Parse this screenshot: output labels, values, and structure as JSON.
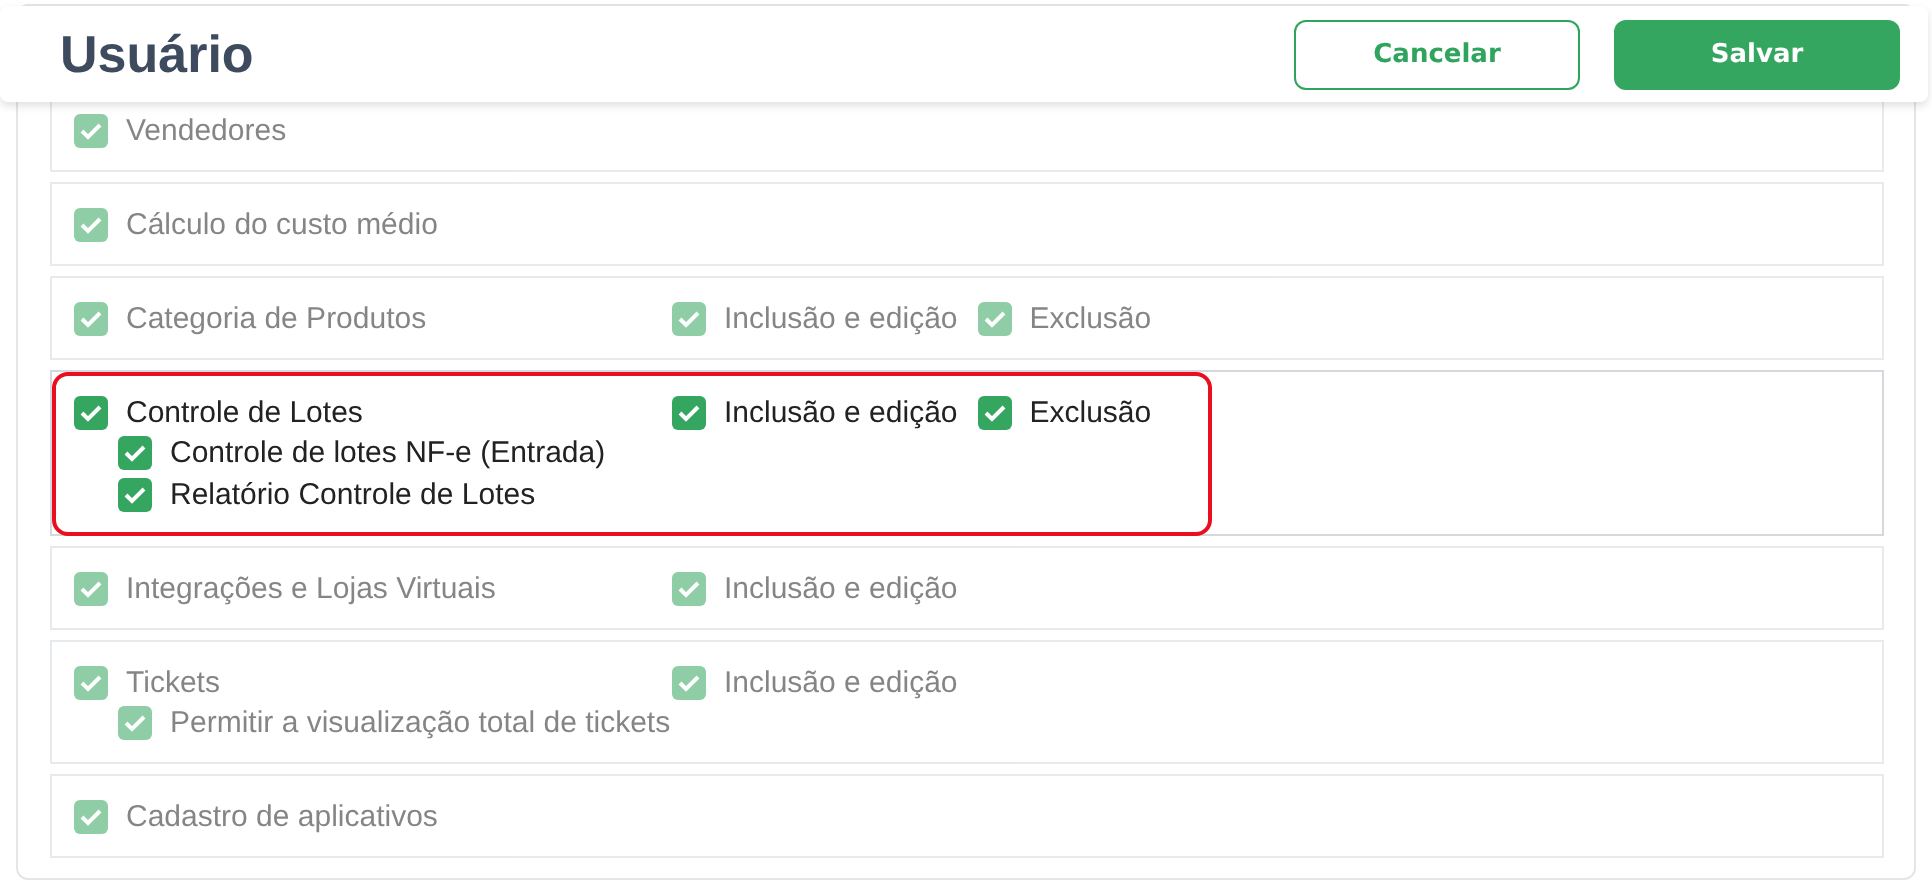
{
  "header": {
    "title": "Usuário",
    "buttons": [
      {
        "label": "Cancelar",
        "kind": "outline"
      },
      {
        "label": "Salvar",
        "kind": "primary"
      }
    ]
  },
  "sections": [
    {
      "label": "Vendedores",
      "checked": true,
      "blurred": true,
      "highlighted": false
    },
    {
      "label": "Cálculo do custo médio",
      "checked": true,
      "blurred": true,
      "highlighted": false
    },
    {
      "label": "Categoria de Produtos",
      "checked": true,
      "blurred": true,
      "highlighted": false,
      "permissions": [
        {
          "label": "Inclusão e edição",
          "checked": true
        },
        {
          "label": "Exclusão",
          "checked": true
        }
      ]
    },
    {
      "label": "Controle de Lotes",
      "checked": true,
      "blurred": false,
      "highlighted": true,
      "permissions": [
        {
          "label": "Inclusão e edição",
          "checked": true
        },
        {
          "label": "Exclusão",
          "checked": true
        }
      ],
      "children": [
        {
          "label": "Controle de lotes NF-e (Entrada)",
          "checked": true
        },
        {
          "label": "Relatório Controle de Lotes",
          "checked": true
        }
      ]
    },
    {
      "label": "Integrações e Lojas Virtuais",
      "checked": true,
      "blurred": true,
      "highlighted": false,
      "permissions": [
        {
          "label": "Inclusão e edição",
          "checked": true
        }
      ]
    },
    {
      "label": "Tickets",
      "checked": true,
      "blurred": true,
      "highlighted": false,
      "permissions": [
        {
          "label": "Inclusão e edição",
          "checked": true
        }
      ],
      "children": [
        {
          "label": "Permitir a visualização total de tickets",
          "checked": true
        }
      ]
    },
    {
      "label": "Cadastro de aplicativos",
      "checked": true,
      "blurred": true,
      "highlighted": false
    }
  ]
}
